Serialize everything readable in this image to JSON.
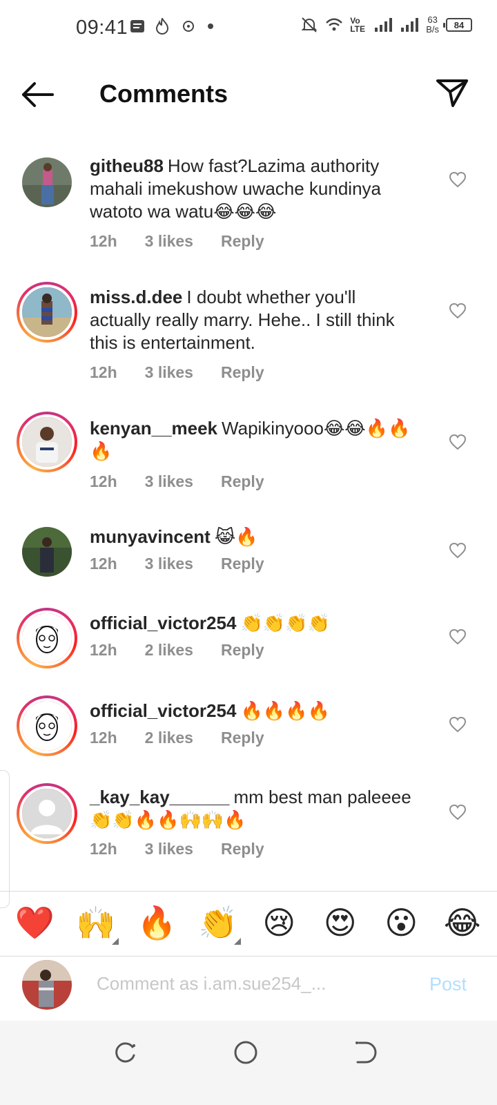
{
  "status_bar": {
    "time": "09:41",
    "speed_value": "63",
    "speed_unit": "B/s",
    "battery": "84",
    "network": "Vo LTE"
  },
  "header": {
    "title": "Comments"
  },
  "comments": [
    {
      "username": "githeu88",
      "text": "How fast?Lazima authority mahali imekushow uwache kundinya watoto wa watu😂😂😂",
      "time": "12h",
      "likes": "3 likes",
      "reply": "Reply",
      "story_ring": false
    },
    {
      "username": "miss.d.dee",
      "text": "I doubt whether you'll actually really marry. Hehe.. I still think this is entertainment.",
      "time": "12h",
      "likes": "3 likes",
      "reply": "Reply",
      "story_ring": true
    },
    {
      "username": "kenyan__meek",
      "text": "Wapikinyooo😂😂🔥🔥🔥",
      "time": "12h",
      "likes": "3 likes",
      "reply": "Reply",
      "story_ring": true
    },
    {
      "username": "munyavincent",
      "text": "😹🔥",
      "time": "12h",
      "likes": "3 likes",
      "reply": "Reply",
      "story_ring": false
    },
    {
      "username": "official_victor254",
      "text": "👏👏👏👏",
      "time": "12h",
      "likes": "2 likes",
      "reply": "Reply",
      "story_ring": true
    },
    {
      "username": "official_victor254",
      "text": "🔥🔥🔥🔥",
      "time": "12h",
      "likes": "2 likes",
      "reply": "Reply",
      "story_ring": true
    },
    {
      "username": "_kay_kay______",
      "text": "mm best man paleeee 👏👏🔥🔥🙌🙌🔥",
      "time": "12h",
      "likes": "3 likes",
      "reply": "Reply",
      "story_ring": true
    }
  ],
  "emoji_bar": [
    "❤️",
    "🙌",
    "🔥",
    "👏",
    "😢",
    "😍",
    "😮",
    "😂"
  ],
  "composer": {
    "placeholder": "Comment as i.am.sue254_...",
    "post_label": "Post"
  },
  "colors": {
    "accent_blue": "#0095f6",
    "post_disabled": "#b2dffc",
    "muted_text": "#8e8e8e"
  }
}
